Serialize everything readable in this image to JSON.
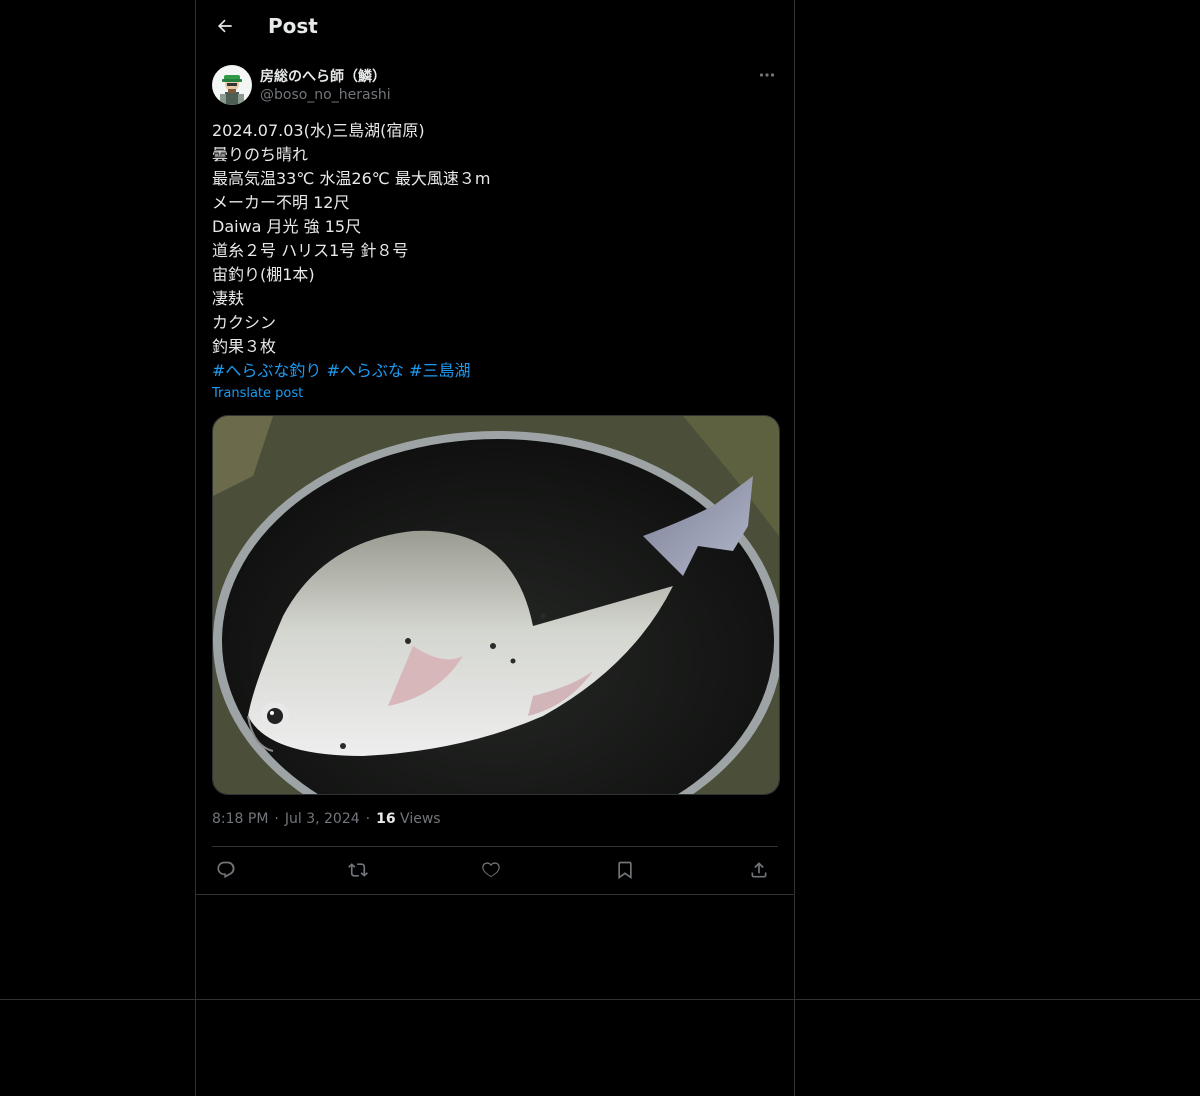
{
  "header": {
    "title": "Post",
    "back_icon": "back-arrow-icon"
  },
  "author": {
    "display_name": "房総のへら師（鱗）",
    "handle": "@boso_no_herashi",
    "avatar_icon": "user-avatar"
  },
  "post": {
    "lines": [
      "2024.07.03(水)三島湖(宿原)",
      "曇りのち晴れ",
      "最高気温33℃ 水温26℃ 最大風速３m",
      "メーカー不明 12尺",
      "Daiwa 月光 強 15尺",
      "道糸２号 ハリス1号 針８号",
      "宙釣り(棚1本)",
      "凄麸",
      "カクシン",
      "釣果３枚"
    ],
    "hashtags": [
      "#へらぶな釣り",
      "#へらぶな",
      "#三島湖"
    ],
    "translate_label": "Translate post"
  },
  "meta": {
    "time": "8:18 PM",
    "date": "Jul 3, 2024",
    "views_count": "16",
    "views_label": "Views"
  },
  "actions": [
    "reply-icon",
    "repost-icon",
    "like-icon",
    "bookmark-icon",
    "share-icon"
  ],
  "colors": {
    "background": "#000000",
    "text": "#e7e9ea",
    "muted": "#71767b",
    "accent": "#1d9bf0",
    "border": "#2f3336"
  }
}
